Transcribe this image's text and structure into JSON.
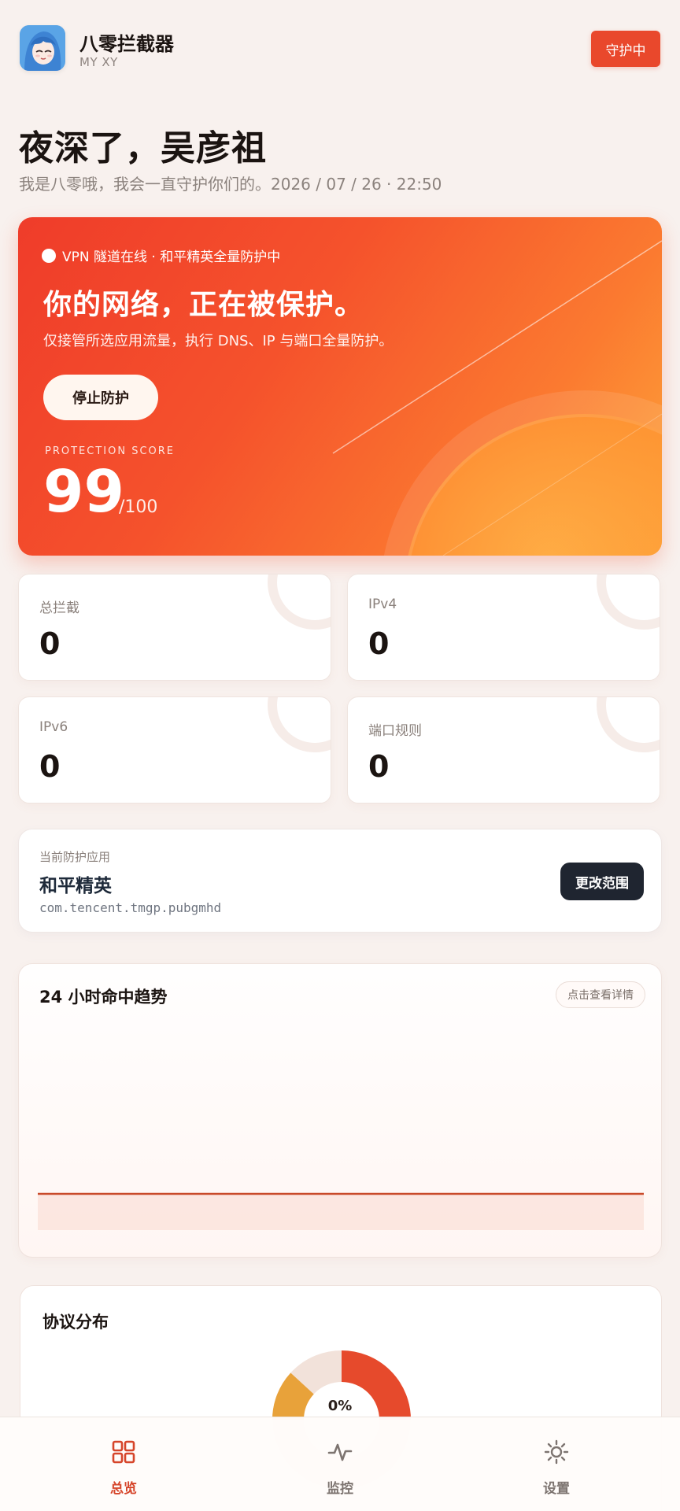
{
  "header": {
    "app_name": "八零拦截器",
    "app_subtitle": "MY XY",
    "guard_status": "守护中",
    "avatar_icon": "anime-avatar-icon"
  },
  "greeting": {
    "title": "夜深了，吴彦祖",
    "subtitle": "我是八零哦，我会一直守护你们的。2026 / 07 / 26 · 22:50"
  },
  "hero": {
    "status_text": "VPN 隧道在线 · 和平精英全量防护中",
    "title": "你的网络，正在被保护。",
    "description": "仅接管所选应用流量，执行 DNS、IP 与端口全量防护。",
    "stop_button": "停止防护",
    "score_label": "PROTECTION SCORE",
    "score": "99",
    "score_max": "/100",
    "score_fraction": 0.99
  },
  "stats": [
    {
      "label": "总拦截",
      "value": "0"
    },
    {
      "label": "IPv4",
      "value": "0"
    },
    {
      "label": "IPv6",
      "value": "0"
    },
    {
      "label": "端口规则",
      "value": "0"
    }
  ],
  "current_app": {
    "label": "当前防护应用",
    "name": "和平精英",
    "package": "com.tencent.tmgp.pubgmhd",
    "change_button": "更改范围"
  },
  "trend": {
    "title": "24 小时命中趋势",
    "detail_link": "点击查看详情"
  },
  "protocol": {
    "title": "协议分布",
    "center_label": "0%"
  },
  "nav": {
    "items": [
      {
        "label": "总览",
        "icon": "grid-icon",
        "active": true
      },
      {
        "label": "监控",
        "icon": "pulse-icon",
        "active": false
      },
      {
        "label": "设置",
        "icon": "gear-icon",
        "active": false
      }
    ]
  },
  "colors": {
    "accent": "#e9482c",
    "background": "#f8f1ee",
    "nav_active": "#d6452a",
    "nav_inactive": "#7d7470"
  }
}
